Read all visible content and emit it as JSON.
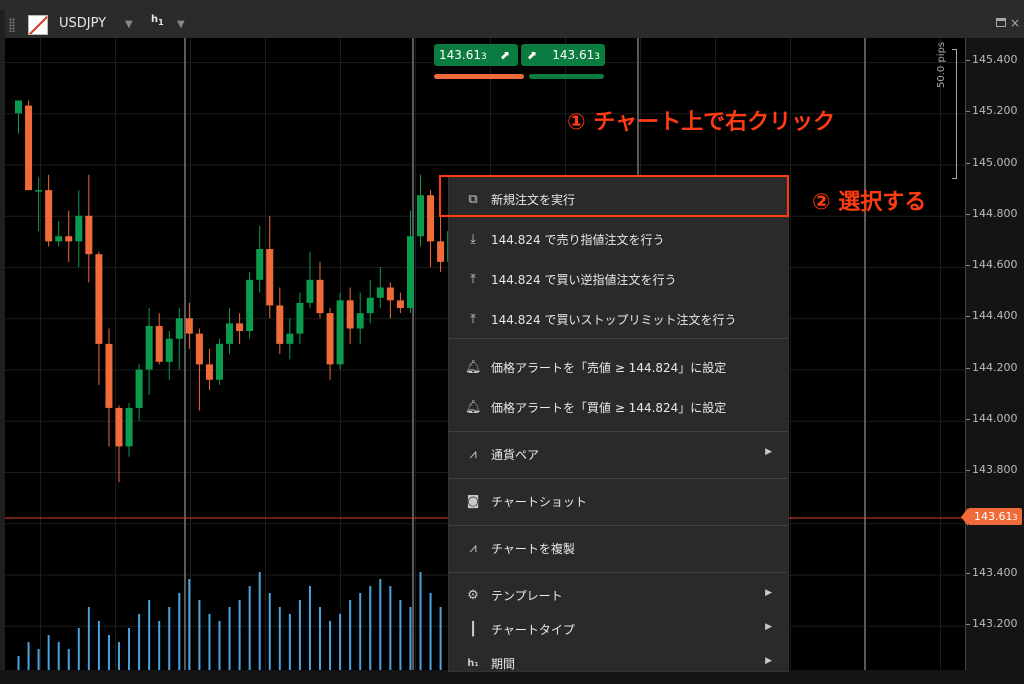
{
  "window": {
    "symbol": "USDJPY",
    "timeframe": {
      "letter": "h",
      "number": "1"
    }
  },
  "trade_buttons": {
    "sell": {
      "price_main": "143.61",
      "price_sup": "3"
    },
    "buy": {
      "price_main": "143.61",
      "price_sup": "3"
    }
  },
  "price_axis": {
    "ticks": [
      "145.400",
      "145.200",
      "145.000",
      "144.800",
      "144.600",
      "144.400",
      "144.200",
      "144.000",
      "143.800",
      "143.600",
      "143.400",
      "143.200"
    ],
    "last_price_main": "143.61",
    "last_price_sup": "3",
    "pips_label": "50.0 pips"
  },
  "annotations": {
    "step1": "① チャート上で右クリック",
    "step2": "② 選択する"
  },
  "context_menu": {
    "items": [
      {
        "label": "新規注文を実行",
        "icon": "new-order-icon"
      },
      {
        "label": "144.824 で売り指値注文を行う",
        "icon": "sell-limit-icon"
      },
      {
        "label": "144.824 で買い逆指値注文を行う",
        "icon": "buy-stop-icon"
      },
      {
        "label": "144.824 で買いストップリミット注文を行う",
        "icon": "buy-stop-limit-icon"
      },
      {
        "label": "価格アラートを「売値 ≥ 144.824」に設定",
        "icon": "bell-icon"
      },
      {
        "label": "価格アラートを「買値 ≥ 144.824」に設定",
        "icon": "bell-icon"
      },
      {
        "label": "通貨ペア",
        "icon": "chart-line-icon"
      },
      {
        "label": "チャートショット",
        "icon": "camera-icon"
      },
      {
        "label": "チャートを複製",
        "icon": "duplicate-chart-icon"
      },
      {
        "label": "テンプレート",
        "icon": "template-icon"
      },
      {
        "label": "チャートタイプ",
        "icon": "candlestick-icon"
      },
      {
        "label": "期間",
        "icon": "period-icon"
      }
    ]
  },
  "colors": {
    "bull": "#0b9b4e",
    "bear": "#f06a3a",
    "volume": "#4aa3df",
    "annotation": "#ff3b12"
  },
  "chart_data": {
    "type": "candlestick",
    "ylim": [
      143.07,
      145.5
    ],
    "candles": [
      {
        "o": 145.2,
        "h": 145.25,
        "l": 145.12,
        "c": 145.25
      },
      {
        "o": 145.23,
        "h": 145.25,
        "l": 144.9,
        "c": 144.9
      },
      {
        "o": 144.9,
        "h": 144.95,
        "l": 144.74,
        "c": 144.9
      },
      {
        "o": 144.9,
        "h": 144.96,
        "l": 144.68,
        "c": 144.7
      },
      {
        "o": 144.7,
        "h": 144.78,
        "l": 144.68,
        "c": 144.72
      },
      {
        "o": 144.72,
        "h": 144.82,
        "l": 144.62,
        "c": 144.7
      },
      {
        "o": 144.7,
        "h": 144.9,
        "l": 144.6,
        "c": 144.8
      },
      {
        "o": 144.8,
        "h": 144.96,
        "l": 144.54,
        "c": 144.65
      },
      {
        "o": 144.65,
        "h": 144.66,
        "l": 144.14,
        "c": 144.3
      },
      {
        "o": 144.3,
        "h": 144.36,
        "l": 143.9,
        "c": 144.05
      },
      {
        "o": 144.05,
        "h": 144.06,
        "l": 143.76,
        "c": 143.9
      },
      {
        "o": 143.9,
        "h": 144.07,
        "l": 143.86,
        "c": 144.05
      },
      {
        "o": 144.05,
        "h": 144.22,
        "l": 144.0,
        "c": 144.2
      },
      {
        "o": 144.2,
        "h": 144.44,
        "l": 144.1,
        "c": 144.37
      },
      {
        "o": 144.37,
        "h": 144.42,
        "l": 144.22,
        "c": 144.23
      },
      {
        "o": 144.23,
        "h": 144.35,
        "l": 144.16,
        "c": 144.32
      },
      {
        "o": 144.32,
        "h": 144.44,
        "l": 144.2,
        "c": 144.4
      },
      {
        "o": 144.4,
        "h": 144.46,
        "l": 144.28,
        "c": 144.34
      },
      {
        "o": 144.34,
        "h": 144.36,
        "l": 144.04,
        "c": 144.22
      },
      {
        "o": 144.22,
        "h": 144.28,
        "l": 144.12,
        "c": 144.16
      },
      {
        "o": 144.16,
        "h": 144.32,
        "l": 144.14,
        "c": 144.3
      },
      {
        "o": 144.3,
        "h": 144.44,
        "l": 144.26,
        "c": 144.38
      },
      {
        "o": 144.38,
        "h": 144.42,
        "l": 144.3,
        "c": 144.35
      },
      {
        "o": 144.35,
        "h": 144.58,
        "l": 144.32,
        "c": 144.55
      },
      {
        "o": 144.55,
        "h": 144.76,
        "l": 144.5,
        "c": 144.67
      },
      {
        "o": 144.67,
        "h": 144.8,
        "l": 144.4,
        "c": 144.45
      },
      {
        "o": 144.45,
        "h": 144.52,
        "l": 144.26,
        "c": 144.3
      },
      {
        "o": 144.3,
        "h": 144.4,
        "l": 144.24,
        "c": 144.34
      },
      {
        "o": 144.34,
        "h": 144.5,
        "l": 144.3,
        "c": 144.46
      },
      {
        "o": 144.46,
        "h": 144.66,
        "l": 144.44,
        "c": 144.55
      },
      {
        "o": 144.55,
        "h": 144.62,
        "l": 144.4,
        "c": 144.42
      },
      {
        "o": 144.42,
        "h": 144.44,
        "l": 144.16,
        "c": 144.22
      },
      {
        "o": 144.22,
        "h": 144.5,
        "l": 144.2,
        "c": 144.47
      },
      {
        "o": 144.47,
        "h": 144.52,
        "l": 144.3,
        "c": 144.36
      },
      {
        "o": 144.36,
        "h": 144.5,
        "l": 144.3,
        "c": 144.42
      },
      {
        "o": 144.42,
        "h": 144.55,
        "l": 144.38,
        "c": 144.48
      },
      {
        "o": 144.48,
        "h": 144.6,
        "l": 144.44,
        "c": 144.52
      },
      {
        "o": 144.52,
        "h": 144.54,
        "l": 144.4,
        "c": 144.47
      },
      {
        "o": 144.47,
        "h": 144.5,
        "l": 144.42,
        "c": 144.44
      },
      {
        "o": 144.44,
        "h": 144.82,
        "l": 144.42,
        "c": 144.72
      },
      {
        "o": 144.72,
        "h": 144.96,
        "l": 144.68,
        "c": 144.88
      },
      {
        "o": 144.88,
        "h": 144.9,
        "l": 144.6,
        "c": 144.7
      },
      {
        "o": 144.7,
        "h": 144.8,
        "l": 144.58,
        "c": 144.62
      },
      {
        "o": 144.62,
        "h": 144.76,
        "l": 144.58,
        "c": 144.74
      }
    ],
    "volume": [
      2,
      4,
      3,
      5,
      4,
      3,
      6,
      9,
      7,
      5,
      4,
      6,
      8,
      10,
      7,
      9,
      11,
      13,
      10,
      8,
      7,
      9,
      10,
      12,
      14,
      11,
      9,
      8,
      10,
      12,
      9,
      7,
      8,
      10,
      11,
      12,
      13,
      12,
      10,
      9,
      14,
      11,
      9,
      13
    ]
  }
}
